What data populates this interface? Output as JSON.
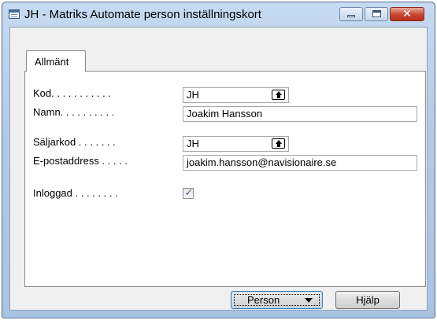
{
  "window": {
    "title": "JH - Matriks Automate person inställningskort",
    "close_glyph": "✕"
  },
  "tabs": [
    {
      "label": "Allmänt",
      "selected": true
    }
  ],
  "form": {
    "kod_label": "Kod. . . . . . . . . . .",
    "kod_value": "JH",
    "namn_label": "Namn. . . . . . . . . .",
    "namn_value": "Joakim Hansson",
    "saljarkod_label": "Säljarkod . . . . . . .",
    "saljarkod_value": "JH",
    "epost_label": "E-postaddress . . . . .",
    "epost_value": "joakim.hansson@navisionaire.se",
    "inloggad_label": "Inloggad . . . . . . . .",
    "inloggad_checked": true,
    "check_glyph": "✓"
  },
  "buttons": {
    "person_label": "Person",
    "help_label": "Hjälp"
  },
  "icons": {
    "app": "form-window-icon",
    "lookup": "lookup-arrow-icon",
    "dropdown": "chevron-down-icon"
  },
  "colors": {
    "titlebar": "#b3cbe7",
    "close_button": "#c9452f",
    "panel": "#ffffff",
    "client": "#f0f0f0"
  }
}
